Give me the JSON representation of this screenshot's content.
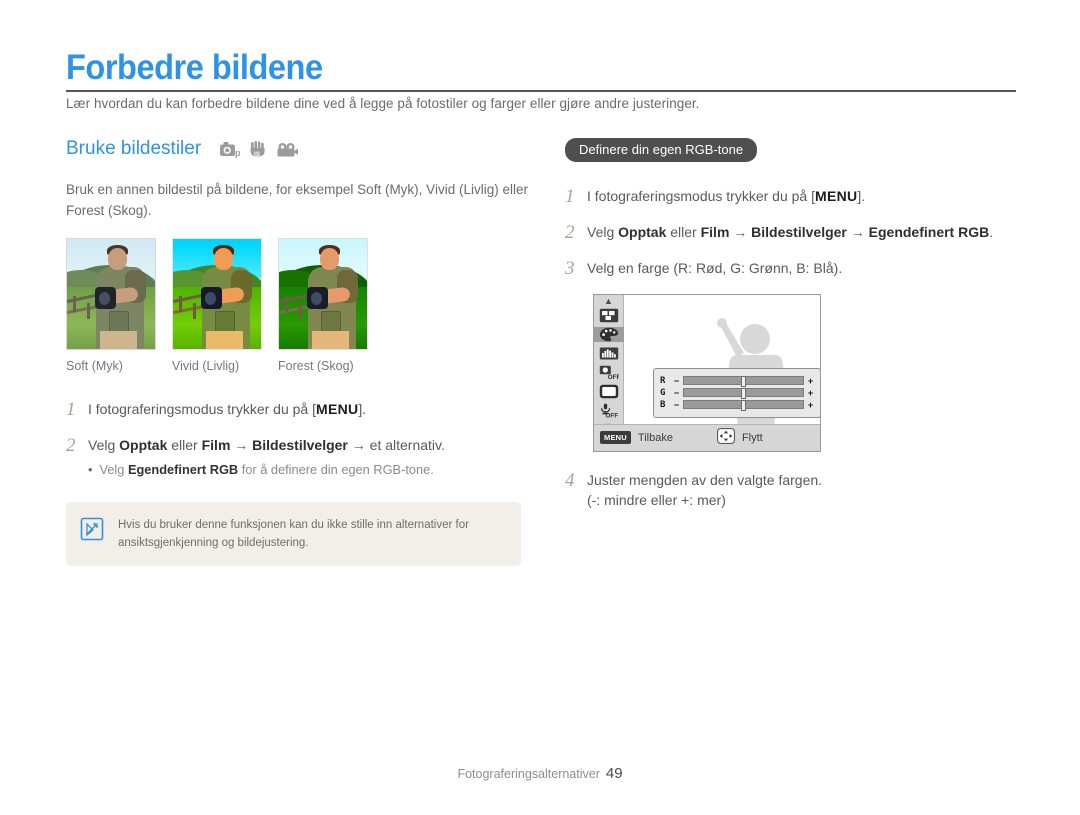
{
  "header": {
    "title": "Forbedre bildene",
    "intro": "Lær hvordan du kan forbedre bildene dine ved å legge på fotostiler og farger eller gjøre andre justeringer."
  },
  "left": {
    "section_title": "Bruke bildestiler",
    "mode_icons": [
      "camera-program-icon",
      "dual-is-icon",
      "movie-icon"
    ],
    "description": "Bruk en annen bildestil på bildene, for eksempel Soft (Myk), Vivid (Livlig) eller Forest (Skog).",
    "thumbnails": [
      {
        "style": "soft",
        "label": "Soft (Myk)"
      },
      {
        "style": "vivid",
        "label": "Vivid (Livlig)"
      },
      {
        "style": "forest",
        "label": "Forest (Skog)"
      }
    ],
    "steps": [
      {
        "num": "1",
        "pre": "I fotograferingsmodus trykker du på [",
        "key": "MENU",
        "post": "]."
      },
      {
        "num": "2",
        "pre": "Velg ",
        "b1": "Opptak",
        "mid1": " eller ",
        "b2": "Film",
        "mid2": " → ",
        "b3": "Bildestilvelger",
        "post": " → et alternativ.",
        "bullet": {
          "dot": "•",
          "pre": "Velg ",
          "bold": "Egendefinert RGB",
          "post": " for å definere din egen RGB-tone."
        }
      }
    ],
    "note": {
      "icon": "note-pen-icon",
      "text": "Hvis du bruker denne funksjonen kan du ikke stille inn alternativer for ansiktsgjenkjenning og bildejustering."
    }
  },
  "right": {
    "badge": "Definere din egen RGB-tone",
    "steps": [
      {
        "num": "1",
        "pre": "I fotograferingsmodus trykker du på [",
        "key": "MENU",
        "post": "]."
      },
      {
        "num": "2",
        "pre": "Velg ",
        "b1": "Opptak",
        "mid1": " eller ",
        "b2": "Film",
        "mid2": " → ",
        "b3": "Bildestilvelger",
        "mid3": " → ",
        "b4": "Egendefinert RGB",
        "post": "."
      },
      {
        "num": "3",
        "text": "Velg en farge (R: Rød, G: Grønn, B: Blå)."
      },
      {
        "num": "4",
        "line1": "Juster mengden av den valgte fargen.",
        "line2": "(-: mindre eller +: mer)"
      }
    ],
    "lcd": {
      "side_icons": [
        "chevron-up-icon",
        "focus-area-icon",
        "color-palette-icon",
        "histogram-icon",
        "face-detect-off-icon",
        "display-icon",
        "voice-memo-off-icon",
        "chevron-down-icon"
      ],
      "selected_side_icon": "color-palette-icon",
      "sliders": [
        {
          "label": "R",
          "minus": "−",
          "plus": "+",
          "value": 50
        },
        {
          "label": "G",
          "minus": "−",
          "plus": "+",
          "value": 50
        },
        {
          "label": "B",
          "minus": "−",
          "plus": "+",
          "value": 50
        }
      ],
      "bottom_bar": {
        "menu_chip": "MENU",
        "back_label": "Tilbake",
        "dpad_icon": "four-way-dpad-icon",
        "move_label": "Flytt"
      }
    }
  },
  "footer": {
    "section": "Fotograferingsalternativer",
    "page": "49"
  },
  "colors": {
    "accent_blue": "#2e93e6",
    "badge_gray": "#4f4f4f",
    "note_bg": "#f2efe9",
    "step_num": "#b0a08f"
  }
}
